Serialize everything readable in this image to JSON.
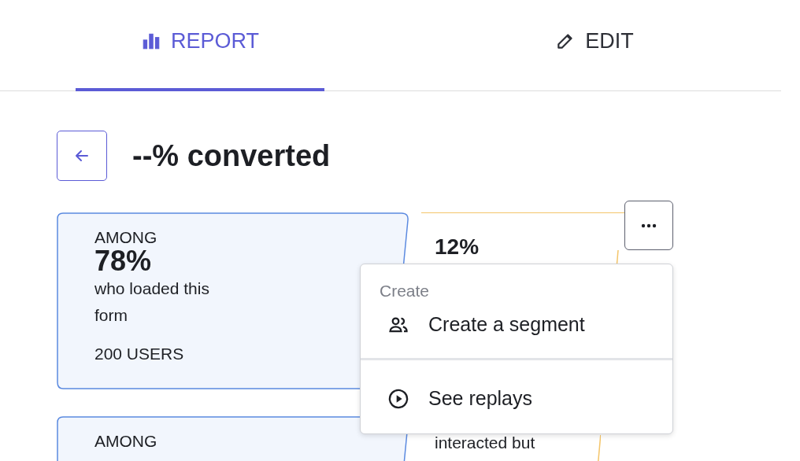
{
  "tabs": [
    {
      "label": "REPORT",
      "kind": "chart",
      "selected": true
    },
    {
      "label": "EDIT",
      "kind": "pencil",
      "selected": false
    }
  ],
  "title": "--% converted",
  "steps": [
    {
      "label": "AMONG",
      "percent": "78%",
      "description": "who loaded this form",
      "users": "200 USERS",
      "dropoff": "12%"
    },
    {
      "label": "AMONG",
      "dropoff": "interacted but"
    }
  ],
  "menu": {
    "heading": "Create",
    "items": [
      {
        "label": "Create a segment",
        "kind": "people"
      },
      {
        "label": "See replays",
        "kind": "play"
      }
    ]
  }
}
